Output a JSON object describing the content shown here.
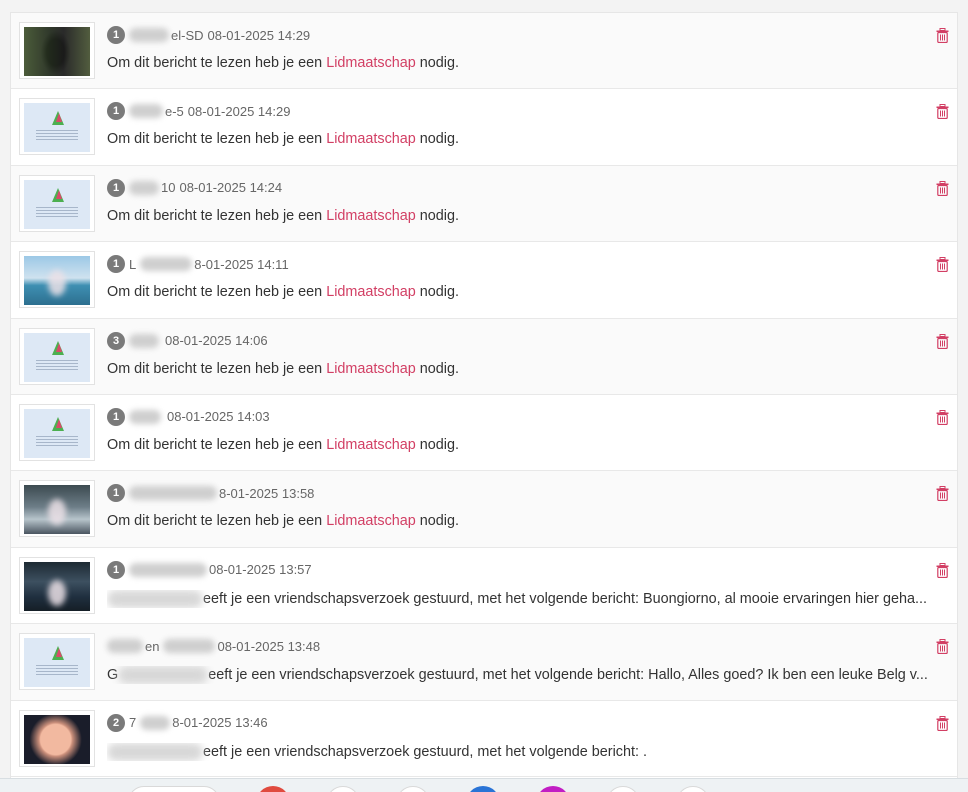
{
  "colors": {
    "accent": "#d23f64",
    "badge": "#7a7a7a",
    "text": "#333333",
    "muted": "#666666"
  },
  "messages": {
    "locked_prefix": "Om dit bericht te lezen heb je een",
    "locked_link": "Lidmaatschap",
    "locked_suffix": "nodig."
  },
  "rows": [
    {
      "count": "1",
      "name_visible": "el-SD",
      "date": "08-01-2025 14:29",
      "thumb": "dark",
      "type": "locked"
    },
    {
      "count": "1",
      "name_visible": "e-5",
      "date": "08-01-2025 14:29",
      "thumb": "logo",
      "type": "locked"
    },
    {
      "count": "1",
      "name_visible": "10",
      "date": "08-01-2025 14:24",
      "thumb": "logo",
      "type": "locked"
    },
    {
      "count": "1",
      "name_visible": "L",
      "date": "8-01-2025 14:11",
      "thumb": "sea",
      "type": "locked"
    },
    {
      "count": "3",
      "name_visible": "",
      "date": "08-01-2025 14:06",
      "thumb": "logo",
      "type": "locked"
    },
    {
      "count": "1",
      "name_visible": "",
      "date": "08-01-2025 14:03",
      "thumb": "logo",
      "type": "locked"
    },
    {
      "count": "1",
      "name_visible": "",
      "date": "8-01-2025 13:58",
      "thumb": "boat",
      "type": "locked"
    },
    {
      "count": "1",
      "name_visible": "",
      "date": "08-01-2025 13:57",
      "thumb": "night",
      "type": "friend",
      "text": "eeft je een vriendschapsverzoek gestuurd, met het volgende bericht: Buongiorno, al mooie ervaringen hier geha..."
    },
    {
      "count": "",
      "name_visible": "en",
      "date": "08-01-2025 13:48",
      "thumb": "logo",
      "type": "friend",
      "text_prefix": "G",
      "text": "eeft je een vriendschapsverzoek gestuurd, met het volgende bericht: Hallo, Alles goed? Ik ben een leuke Belg v..."
    },
    {
      "count": "2",
      "name_visible": "7",
      "date": "8-01-2025 13:46",
      "thumb": "face",
      "type": "friend",
      "text": "eeft je een vriendschapsverzoek gestuurd, met het volgende bericht: ."
    }
  ],
  "icons": {
    "delete": "trash-icon"
  }
}
